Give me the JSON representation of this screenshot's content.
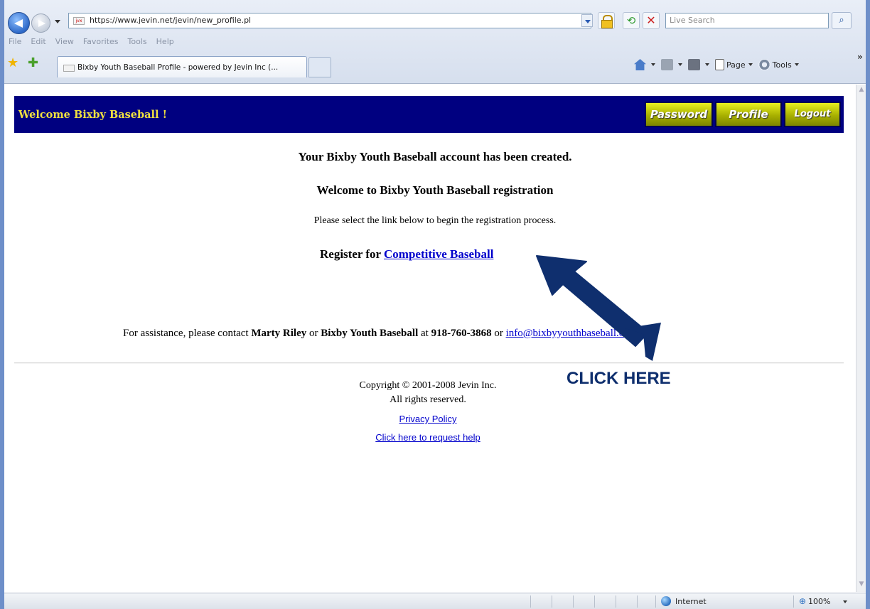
{
  "browser": {
    "url": "https://www.jevin.net/jevin/new_profile.pl",
    "search_placeholder": "Live Search",
    "menu": [
      "File",
      "Edit",
      "View",
      "Favorites",
      "Tools",
      "Help"
    ],
    "tab_title": "Bixby Youth Baseball Profile - powered by Jevin Inc (...",
    "commands": {
      "page": "Page",
      "tools": "Tools"
    },
    "status": {
      "zone": "Internet",
      "zoom": "100%"
    }
  },
  "banner": {
    "title": "Welcome Bixby Baseball !",
    "buttons": {
      "password": "Password",
      "profile": "Profile",
      "logout": "Logout"
    }
  },
  "main": {
    "heading_created": "Your Bixby Youth Baseball account has been created.",
    "heading_welcome": "Welcome to Bixby Youth Baseball registration",
    "instruction": "Please select the link below to begin the registration process.",
    "register_prefix": "Register for ",
    "register_link": "Competitive Baseball",
    "assistance": {
      "prefix": "For assistance, please contact ",
      "contact_name": "Marty Riley",
      "or1": " or ",
      "org": "Bixby Youth Baseball",
      "at": " at ",
      "phone": "918-760-3868",
      "or2": " or ",
      "email": "info@bixbyyouthbaseball.org"
    }
  },
  "footer": {
    "copyright": "Copyright © 2001-2008 Jevin Inc.",
    "rights": "All rights reserved.",
    "privacy": "Privacy Policy",
    "help": "Click here to request help"
  },
  "annotation": {
    "label": "CLICK HERE",
    "color": "#0f2f6e"
  }
}
